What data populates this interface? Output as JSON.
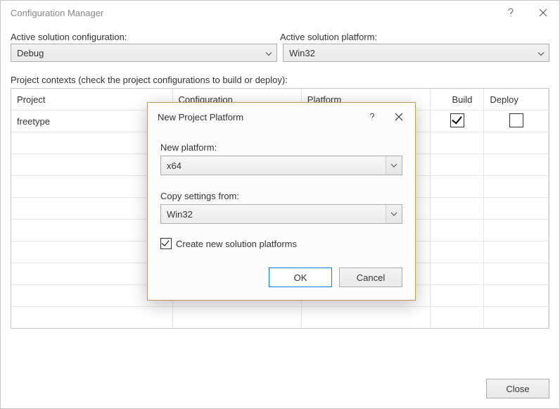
{
  "window": {
    "title": "Configuration Manager"
  },
  "labels": {
    "active_config": "Active solution configuration:",
    "active_platform": "Active solution platform:",
    "contexts": "Project contexts (check the project configurations to build or deploy):"
  },
  "selects": {
    "active_config_value": "Debug",
    "active_platform_value": "Win32"
  },
  "grid": {
    "headers": {
      "project": "Project",
      "configuration": "Configuration",
      "platform": "Platform",
      "build": "Build",
      "deploy": "Deploy"
    },
    "rows": [
      {
        "project": "freetype",
        "build_checked": true,
        "deploy_checked": false
      }
    ]
  },
  "buttons": {
    "close": "Close"
  },
  "modal": {
    "title": "New Project Platform",
    "new_platform_label": "New platform:",
    "new_platform_value": "x64",
    "copy_settings_label": "Copy settings from:",
    "copy_settings_value": "Win32",
    "create_new_label": "Create new solution platforms",
    "create_new_checked": true,
    "ok": "OK",
    "cancel": "Cancel"
  }
}
